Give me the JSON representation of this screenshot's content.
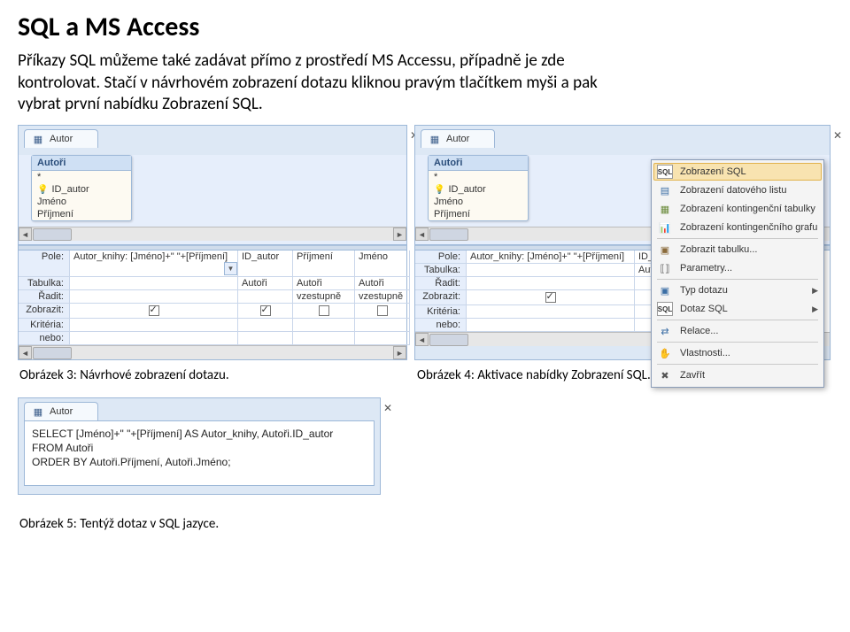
{
  "title": "SQL a MS Access",
  "paragraph": "Příkazy SQL můžeme také zadávat přímo z prostředí MS Accessu, případně je zde kontrolovat. Stačí v návrhovém zobrazení dotazu kliknou pravým tlačítkem myši a pak vybrat první nabídku Zobrazení SQL.",
  "tab_name": "Autor",
  "close_glyph": "✕",
  "table": {
    "name": "Autoři",
    "star": "*",
    "fields": [
      "ID_autor",
      "Jméno",
      "Příjmení"
    ]
  },
  "qbe_labels": {
    "pole": "Pole:",
    "tabulka": "Tabulka:",
    "radit": "Řadit:",
    "zobrazit": "Zobrazit:",
    "kriteria": "Kritéria:",
    "nebo": "nebo:"
  },
  "fig1_cols": [
    {
      "pole": "Autor_knihy: [Jméno]+\" \"+[Příjmení]",
      "tabulka": "",
      "radit": "",
      "show": true,
      "kriteria": "",
      "dropdown": true
    },
    {
      "pole": "ID_autor",
      "tabulka": "Autoři",
      "radit": "",
      "show": true,
      "kriteria": ""
    },
    {
      "pole": "Příjmení",
      "tabulka": "Autoři",
      "radit": "vzestupně",
      "show": false,
      "kriteria": ""
    },
    {
      "pole": "Jméno",
      "tabulka": "Autoři",
      "radit": "vzestupně",
      "show": false,
      "kriteria": ""
    }
  ],
  "fig2_cols": [
    {
      "pole": "Autor_knihy: [Jméno]+\" \"+[Příjmení]",
      "tabulka": "",
      "radit": "",
      "show": true,
      "kriteria": ""
    },
    {
      "pole": "ID_au",
      "tabulka": "Autoři",
      "radit": "",
      "show": true,
      "kriteria": ""
    }
  ],
  "context_menu": [
    {
      "label": "Zobrazení SQL",
      "ico": "sql",
      "hl": true
    },
    {
      "label": "Zobrazení datového listu",
      "ico": "sheet"
    },
    {
      "label": "Zobrazení kontingenční tabulky",
      "ico": "pivot"
    },
    {
      "label": "Zobrazení kontingenčního grafu",
      "ico": "chart"
    },
    {
      "sep": true
    },
    {
      "label": "Zobrazit tabulku...",
      "ico": "showtbl"
    },
    {
      "label": "Parametry...",
      "ico": "param"
    },
    {
      "sep": true
    },
    {
      "label": "Typ dotazu",
      "ico": "qtype",
      "sub": true
    },
    {
      "label": "Dotaz SQL",
      "ico": "qsql",
      "sub": true
    },
    {
      "sep": true
    },
    {
      "label": "Relace...",
      "ico": "rel"
    },
    {
      "sep": true
    },
    {
      "label": "Vlastnosti...",
      "ico": "prop"
    },
    {
      "sep": true
    },
    {
      "label": "Zavřít",
      "ico": "close"
    }
  ],
  "sql_lines": [
    "SELECT [Jméno]+\" \"+[Příjmení] AS Autor_knihy, Autoři.ID_autor",
    "FROM Autoři",
    "ORDER BY Autoři.Příjmení, Autoři.Jméno;"
  ],
  "captions": {
    "fig3": "Obrázek 3: Návrhové zobrazení dotazu.",
    "fig4": "Obrázek 4: Aktivace nabídky Zobrazení SQL.",
    "fig5": "Obrázek 5: Tentýž dotaz v SQL jazyce."
  },
  "arrows": {
    "left": "◄",
    "right": "►",
    "sub": "▶",
    "down": "▼"
  }
}
